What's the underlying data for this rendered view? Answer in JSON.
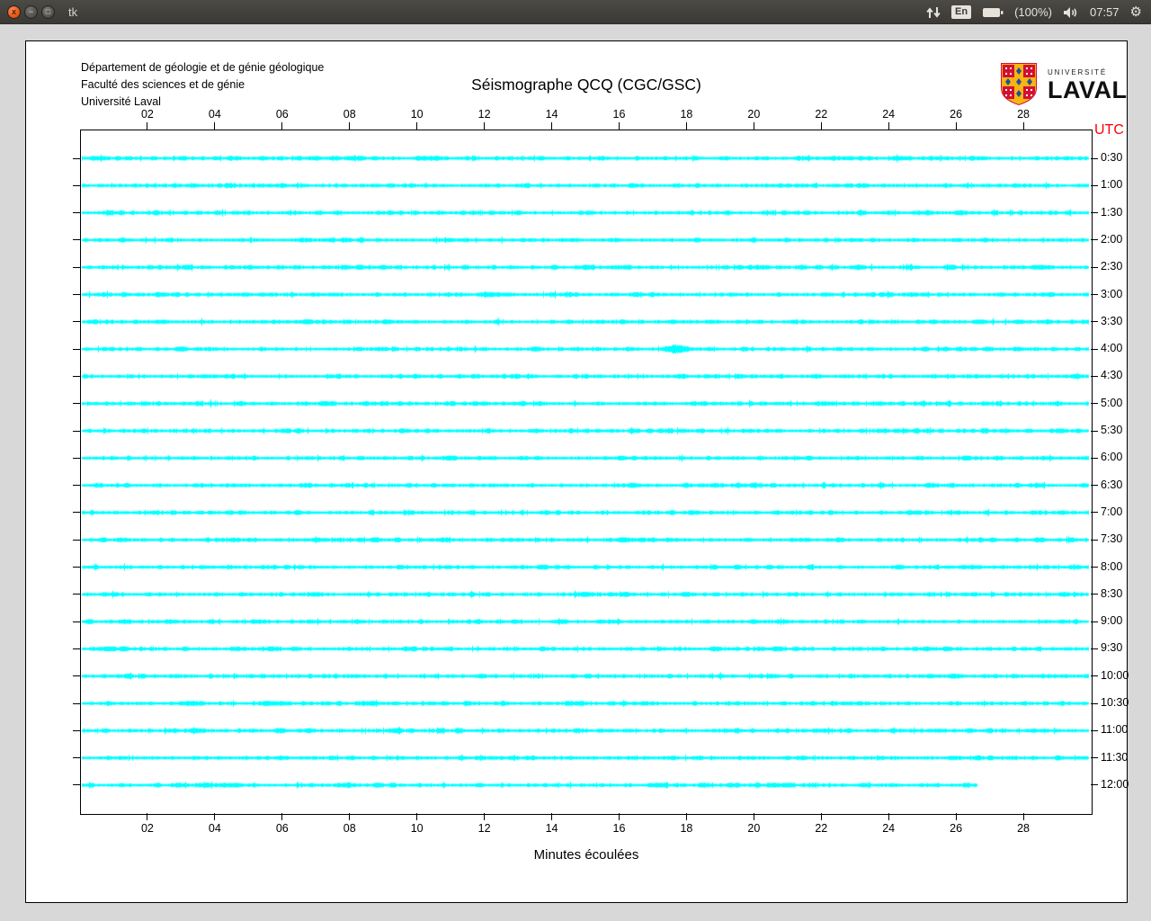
{
  "titlebar": {
    "title": "tk",
    "tray": {
      "keyboard_layout": "En",
      "battery_percent": "(100%)",
      "clock": "07:57"
    }
  },
  "document": {
    "org_lines": [
      "Département de géologie et de génie géologique",
      "Faculté des sciences et de génie",
      "Université Laval"
    ],
    "logo": {
      "word_top": "UNIVERSITÉ",
      "word_bottom": "LAVAL"
    }
  },
  "chart_data": {
    "type": "line",
    "title": "Séismographe QCQ (CGC/GSC)",
    "xlabel": "Minutes écoulées",
    "right_axis_title": "UTC",
    "x_range_minutes": [
      0,
      30
    ],
    "x_ticks": [
      "02",
      "04",
      "06",
      "08",
      "10",
      "12",
      "14",
      "16",
      "18",
      "20",
      "22",
      "24",
      "26",
      "28"
    ],
    "trace_color": "#00ffff",
    "utc_title_color": "#ff0000",
    "minutes_per_trace": 30,
    "traces": [
      {
        "utc": "0:30",
        "end_min": 30
      },
      {
        "utc": "1:00",
        "end_min": 30
      },
      {
        "utc": "1:30",
        "end_min": 30
      },
      {
        "utc": "2:00",
        "end_min": 30
      },
      {
        "utc": "2:30",
        "end_min": 30
      },
      {
        "utc": "3:00",
        "end_min": 30
      },
      {
        "utc": "3:30",
        "end_min": 30
      },
      {
        "utc": "4:00",
        "end_min": 30,
        "burst_min": 17.7
      },
      {
        "utc": "4:30",
        "end_min": 30
      },
      {
        "utc": "5:00",
        "end_min": 30
      },
      {
        "utc": "5:30",
        "end_min": 30
      },
      {
        "utc": "6:00",
        "end_min": 30
      },
      {
        "utc": "6:30",
        "end_min": 30
      },
      {
        "utc": "7:00",
        "end_min": 30
      },
      {
        "utc": "7:30",
        "end_min": 30
      },
      {
        "utc": "8:00",
        "end_min": 30
      },
      {
        "utc": "8:30",
        "end_min": 30
      },
      {
        "utc": "9:00",
        "end_min": 30
      },
      {
        "utc": "9:30",
        "end_min": 30
      },
      {
        "utc": "10:00",
        "end_min": 30
      },
      {
        "utc": "10:30",
        "end_min": 30
      },
      {
        "utc": "11:00",
        "end_min": 30
      },
      {
        "utc": "11:30",
        "end_min": 26.6
      }
    ]
  }
}
